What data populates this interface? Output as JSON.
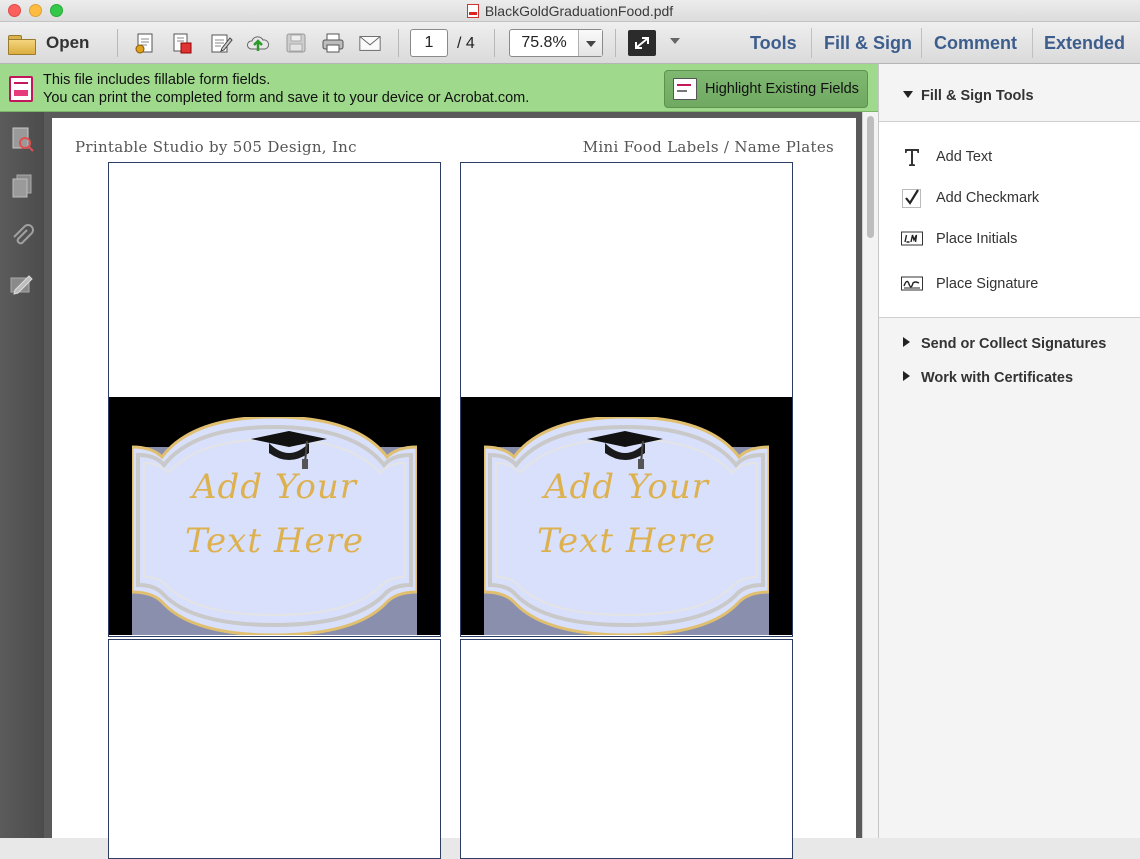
{
  "window": {
    "title": "BlackGoldGraduationFood.pdf"
  },
  "toolbar": {
    "open_label": "Open",
    "page_current": "1",
    "page_total": "/ 4",
    "zoom": "75.8%",
    "tabs": [
      "Tools",
      "Fill & Sign",
      "Comment",
      "Extended"
    ]
  },
  "notice": {
    "line1": "This file includes fillable form fields.",
    "line2": "You can print the completed form and save it to your device or Acrobat.com.",
    "button": "Highlight Existing Fields"
  },
  "document": {
    "header_left": "Printable Studio by 505 Design, Inc",
    "header_right": "Mini Food Labels / Name Plates",
    "card_text_line1": "Add Your",
    "card_text_line2": "Text Here"
  },
  "panel": {
    "title": "Fill & Sign Tools",
    "tools": [
      "Add Text",
      "Add Checkmark",
      "Place Initials",
      "Place Signature"
    ],
    "sections": [
      "Send or Collect Signatures",
      "Work with Certificates"
    ]
  },
  "colors": {
    "notice_bg": "#9fd98c",
    "tab_text": "#3d5d8c",
    "card_gold": "#ddb14f",
    "card_lavender": "#d9e0fb"
  }
}
